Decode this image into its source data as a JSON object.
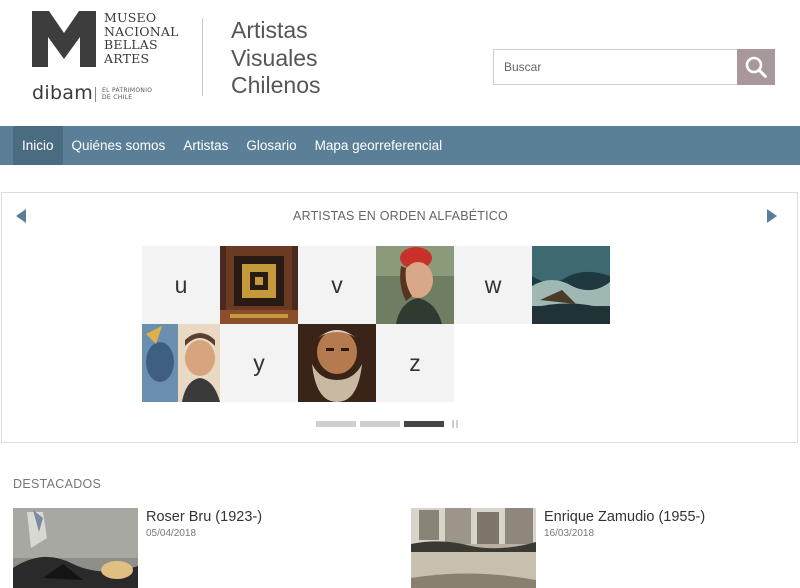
{
  "header": {
    "museo_lines": [
      "MUSEO",
      "NACIONAL",
      "BELLAS",
      "ARTES"
    ],
    "dibam": "dibam",
    "patrimonio_lines": [
      "EL PATRIMONIO",
      "DE CHILE"
    ],
    "site_title_lines": [
      "Artistas",
      "Visuales",
      "Chilenos"
    ],
    "search": {
      "placeholder": "Buscar"
    }
  },
  "nav": {
    "items": [
      "Inicio",
      "Quiénes somos",
      "Artistas",
      "Glosario",
      "Mapa georreferencial"
    ],
    "active": "Inicio"
  },
  "carousel": {
    "title": "ARTISTAS EN ORDEN ALFABÉTICO",
    "letters": [
      "u",
      "v",
      "w",
      "y",
      "z"
    ],
    "pages": 3,
    "active_page": 3
  },
  "destacados": {
    "title": "DESTACADOS",
    "items": [
      {
        "name": "Roser Bru (1923-)",
        "date": "05/04/2018"
      },
      {
        "name": "Enrique Zamudio (1955-)",
        "date": "16/03/2018"
      }
    ]
  },
  "colors": {
    "nav_bg": "#5a7f97",
    "nav_active": "#4a6b80",
    "search_button": "#a9989b",
    "text": "#444444"
  },
  "icons": [
    "museo-m-logo",
    "search-icon",
    "arrow-left-icon",
    "arrow-right-icon",
    "pause-icon"
  ]
}
